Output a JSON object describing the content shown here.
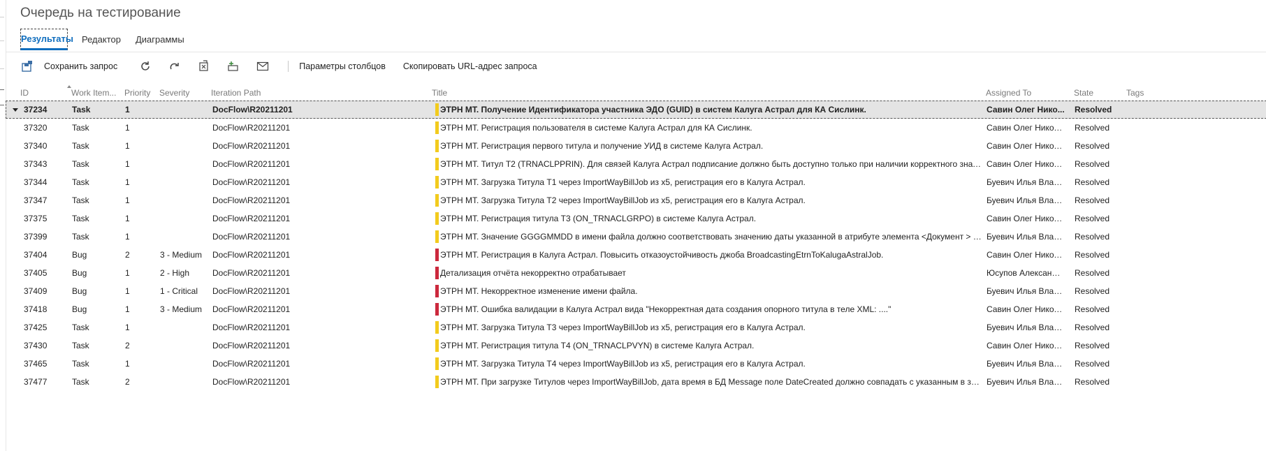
{
  "page": {
    "title": "Очередь на тестирование"
  },
  "tabs": [
    {
      "label": "Результаты",
      "active": true
    },
    {
      "label": "Редактор",
      "active": false
    },
    {
      "label": "Диаграммы",
      "active": false
    }
  ],
  "toolbar": {
    "save_label": "Сохранить запрос",
    "icons": [
      "save-query-icon",
      "refresh-icon",
      "redo-icon",
      "open-in-excel-icon",
      "new-work-item-icon",
      "email-icon"
    ],
    "column_options_label": "Параметры столбцов",
    "copy_url_label": "Скопировать URL-адрес запроса"
  },
  "colors": {
    "task": "#f2cb1d",
    "bug": "#cc293d",
    "accent": "#106ebe"
  },
  "grid": {
    "columns": [
      {
        "key": "id",
        "label": "ID"
      },
      {
        "key": "type",
        "label": "Work Item..."
      },
      {
        "key": "priority",
        "label": "Priority"
      },
      {
        "key": "severity",
        "label": "Severity"
      },
      {
        "key": "iteration",
        "label": "Iteration Path"
      },
      {
        "key": "title",
        "label": "Title"
      },
      {
        "key": "assigned",
        "label": "Assigned To"
      },
      {
        "key": "state",
        "label": "State"
      },
      {
        "key": "tags",
        "label": "Tags"
      }
    ],
    "rows": [
      {
        "id": "37234",
        "type": "Task",
        "priority": "1",
        "severity": "",
        "iteration": "DocFlow\\R20211201",
        "title": "ЭТРН МТ. Получение Идентификатора участника ЭДО (GUID) в систем Калуга Астрал для КА Сислинк.",
        "assigned": "Савин Олег Нико...",
        "state": "Resolved",
        "tags": "",
        "selected": true
      },
      {
        "id": "37320",
        "type": "Task",
        "priority": "1",
        "severity": "",
        "iteration": "DocFlow\\R20211201",
        "title": "ЭТРН МТ. Регистрация пользователя в системе Калуга Астрал для КА Сислинк.",
        "assigned": "Савин Олег Никола...",
        "state": "Resolved",
        "tags": ""
      },
      {
        "id": "37340",
        "type": "Task",
        "priority": "1",
        "severity": "",
        "iteration": "DocFlow\\R20211201",
        "title": "ЭТРН МТ. Регистрация первого титула и получение УИД в системе Калуга Астрал.",
        "assigned": "Савин Олег Никола...",
        "state": "Resolved",
        "tags": ""
      },
      {
        "id": "37343",
        "type": "Task",
        "priority": "1",
        "severity": "",
        "iteration": "DocFlow\\R20211201",
        "title": "ЭТРН МТ. Титул Т2 (TRNACLPPRIN). Для связей Калуга Астрал подписание должно быть доступно только при наличии корректного значен...",
        "assigned": "Савин Олег Никола...",
        "state": "Resolved",
        "tags": ""
      },
      {
        "id": "37344",
        "type": "Task",
        "priority": "1",
        "severity": "",
        "iteration": "DocFlow\\R20211201",
        "title": "ЭТРН МТ. Загрузка Титула Т1 через ImportWayBillJob из x5, регистрация его в Калуга Астрал.",
        "assigned": "Буевич Илья Влади...",
        "state": "Resolved",
        "tags": ""
      },
      {
        "id": "37347",
        "type": "Task",
        "priority": "1",
        "severity": "",
        "iteration": "DocFlow\\R20211201",
        "title": "ЭТРН МТ. Загрузка Титула Т2 через ImportWayBillJob из x5, регистрация его в Калуга Астрал.",
        "assigned": "Буевич Илья Влади...",
        "state": "Resolved",
        "tags": ""
      },
      {
        "id": "37375",
        "type": "Task",
        "priority": "1",
        "severity": "",
        "iteration": "DocFlow\\R20211201",
        "title": "ЭТРН МТ. Регистрация титула Т3 (ON_TRNACLGRPO) в системе Калуга Астрал.",
        "assigned": "Савин Олег Никола...",
        "state": "Resolved",
        "tags": ""
      },
      {
        "id": "37399",
        "type": "Task",
        "priority": "1",
        "severity": "",
        "iteration": "DocFlow\\R20211201",
        "title": "ЭТРН МТ. Значение GGGGMMDD в имени файла должно соответствовать значению даты указанной в атрибуте элемента <Документ > дл...",
        "assigned": "Буевич Илья Влади...",
        "state": "Resolved",
        "tags": ""
      },
      {
        "id": "37404",
        "type": "Bug",
        "priority": "2",
        "severity": "3 - Medium",
        "iteration": "DocFlow\\R20211201",
        "title": "ЭТРН МТ. Регистрация в Калуга Астрал. Повысить отказоустойчивость джоба BroadcastingEtrnToKalugaAstralJob.",
        "assigned": "Савин Олег Никола...",
        "state": "Resolved",
        "tags": ""
      },
      {
        "id": "37405",
        "type": "Bug",
        "priority": "1",
        "severity": "2 - High",
        "iteration": "DocFlow\\R20211201",
        "title": "Детализация отчёта некорректно отрабатывает",
        "assigned": "Юсупов Александр ...",
        "state": "Resolved",
        "tags": ""
      },
      {
        "id": "37409",
        "type": "Bug",
        "priority": "1",
        "severity": "1 - Critical",
        "iteration": "DocFlow\\R20211201",
        "title": "ЭТРН МТ. Некорректное изменение имени файла.",
        "assigned": "Буевич Илья Влади...",
        "state": "Resolved",
        "tags": ""
      },
      {
        "id": "37418",
        "type": "Bug",
        "priority": "1",
        "severity": "3 - Medium",
        "iteration": "DocFlow\\R20211201",
        "title": "ЭТРН МТ. Ошибка валидации в Калуга Астрал вида \"Некорректная дата создания опорного титула в теле XML: ....\"",
        "assigned": "Савин Олег Никола...",
        "state": "Resolved",
        "tags": ""
      },
      {
        "id": "37425",
        "type": "Task",
        "priority": "1",
        "severity": "",
        "iteration": "DocFlow\\R20211201",
        "title": "ЭТРН МТ. Загрузка Титула Т3 через ImportWayBillJob из x5, регистрация его в Калуга Астрал.",
        "assigned": "Буевич Илья Влади...",
        "state": "Resolved",
        "tags": ""
      },
      {
        "id": "37430",
        "type": "Task",
        "priority": "2",
        "severity": "",
        "iteration": "DocFlow\\R20211201",
        "title": "ЭТРН МТ. Регистрация титула Т4 (ON_TRNACLPVYN) в системе Калуга Астрал.",
        "assigned": "Савин Олег Никола...",
        "state": "Resolved",
        "tags": ""
      },
      {
        "id": "37465",
        "type": "Task",
        "priority": "1",
        "severity": "",
        "iteration": "DocFlow\\R20211201",
        "title": "ЭТРН МТ. Загрузка Титула Т4 через ImportWayBillJob из x5, регистрация его в Калуга Астрал.",
        "assigned": "Буевич Илья Влади...",
        "state": "Resolved",
        "tags": ""
      },
      {
        "id": "37477",
        "type": "Task",
        "priority": "2",
        "severity": "",
        "iteration": "DocFlow\\R20211201",
        "title": "ЭТРН МТ. При загрузке Титулов через ImportWayBillJob, дата время в БД Message поле DateCreated должно совпадать с указанным в загр...",
        "assigned": "Буевич Илья Влади...",
        "state": "Resolved",
        "tags": ""
      }
    ]
  }
}
